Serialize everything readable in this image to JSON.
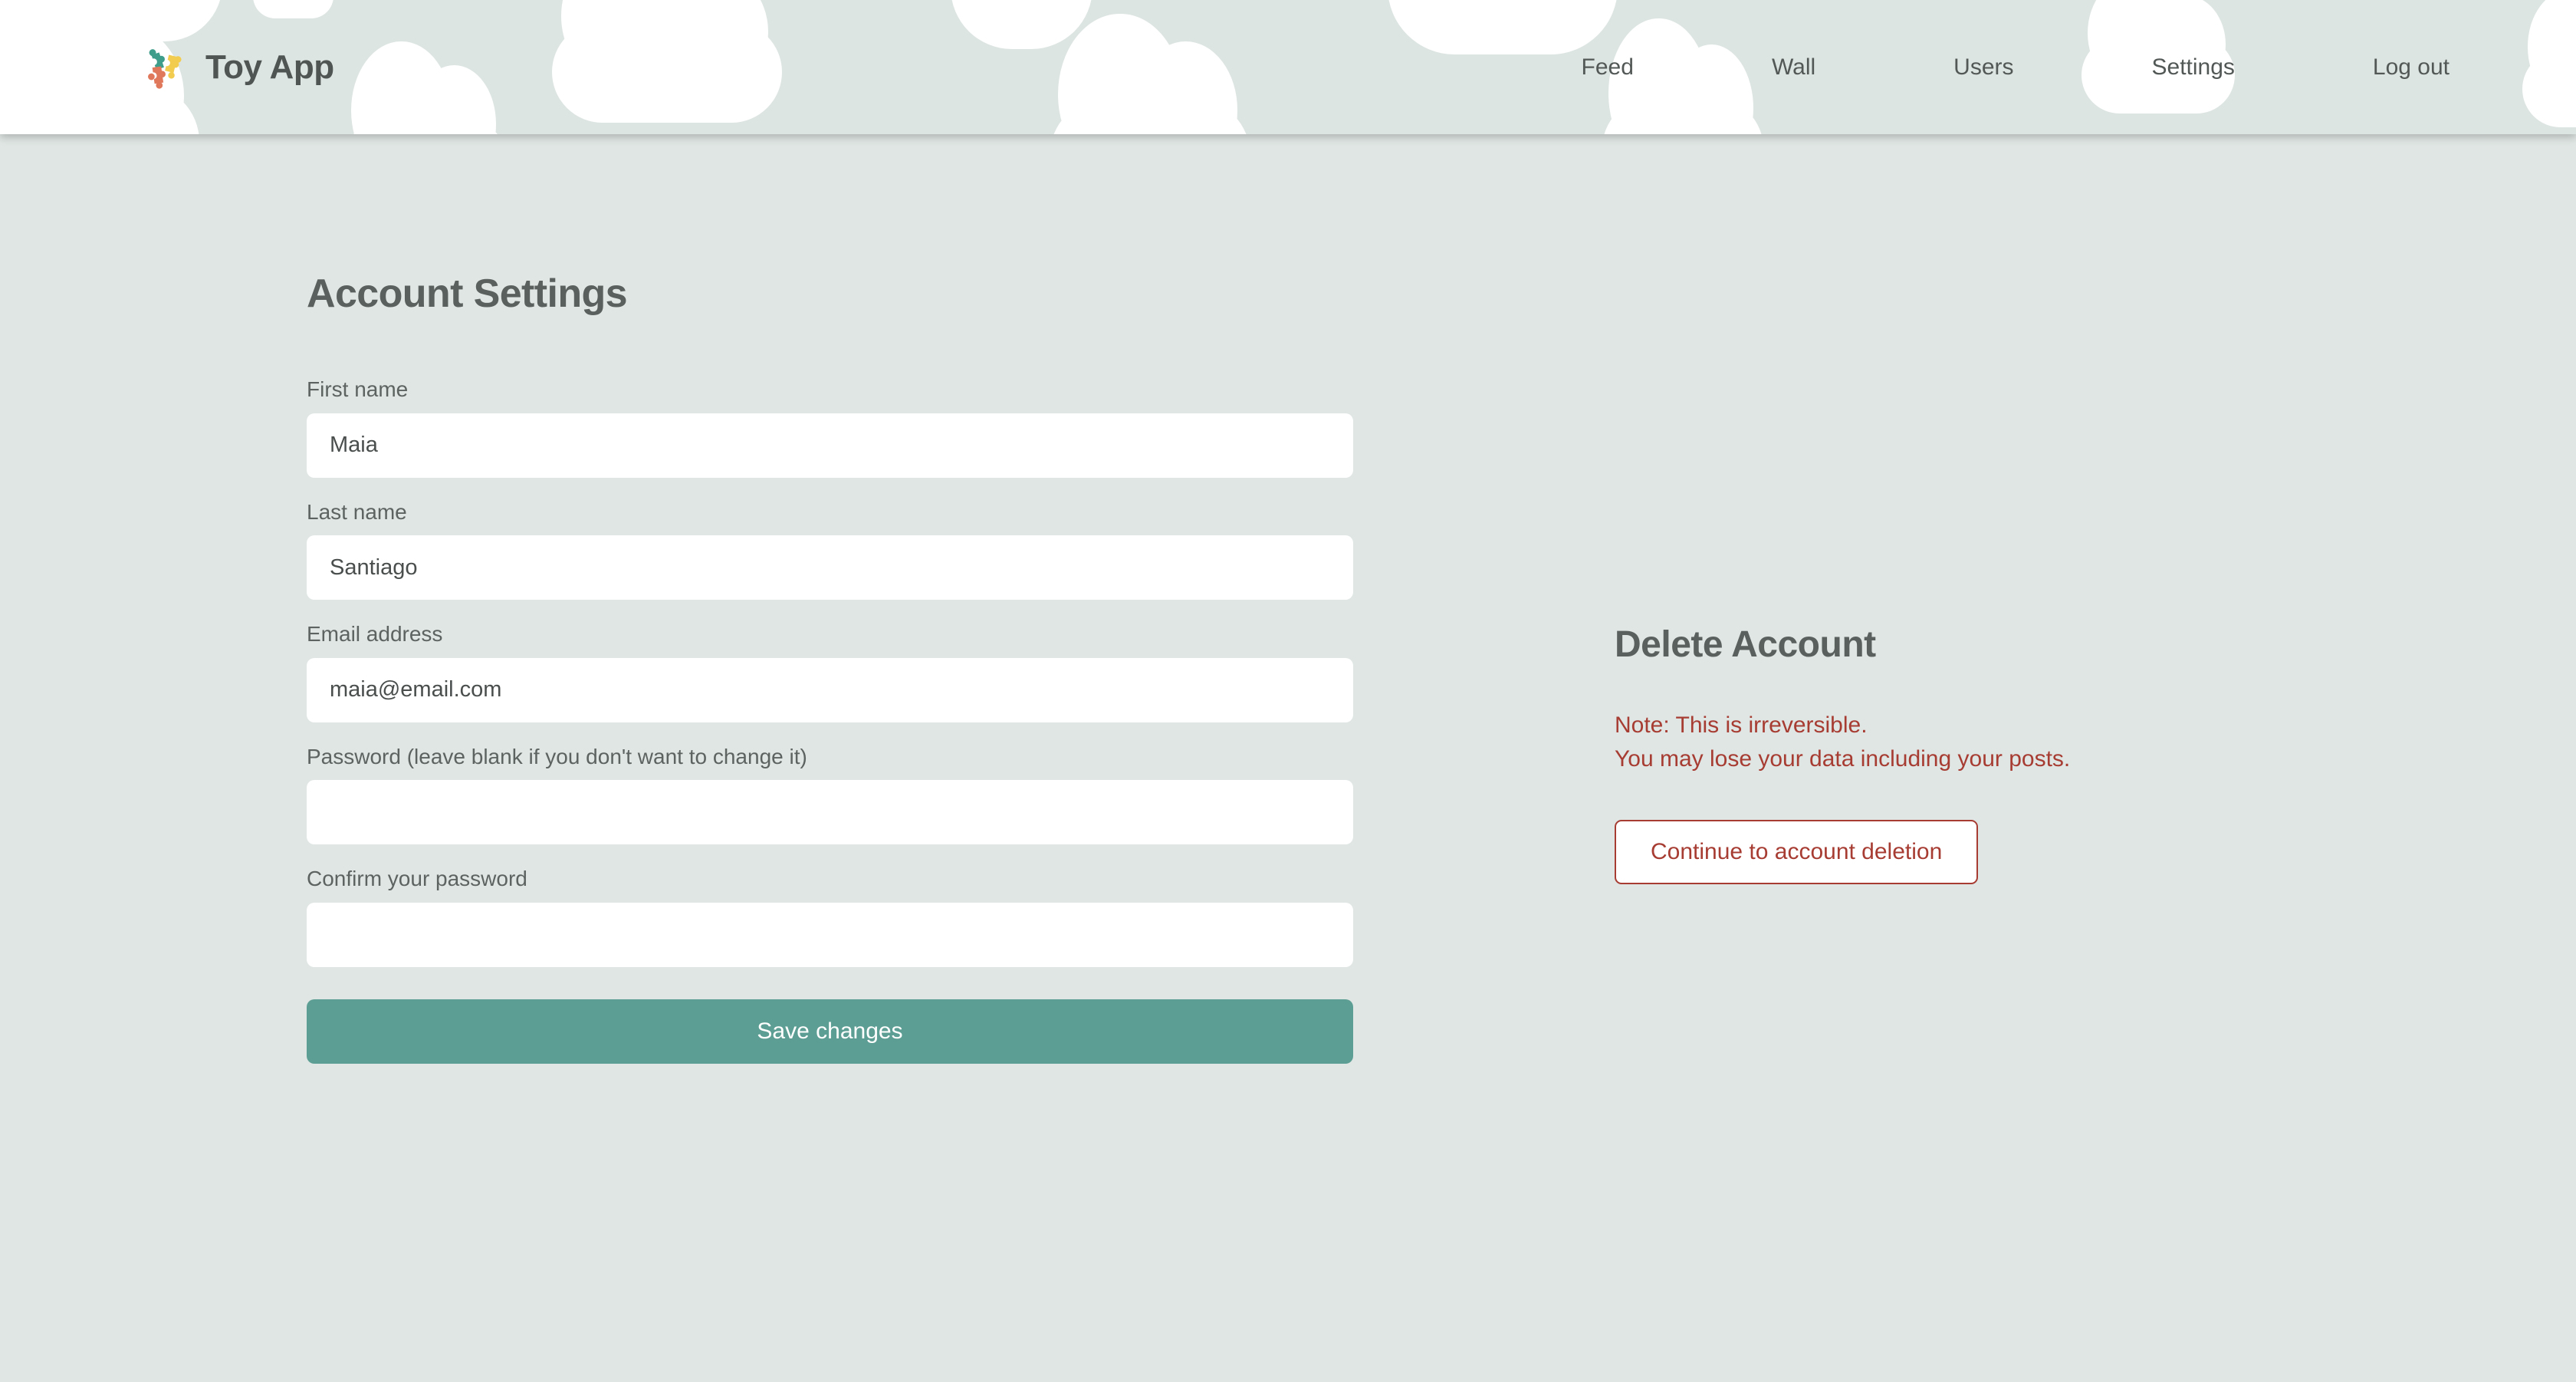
{
  "theme": {
    "background": "#dfe6e3",
    "header_background": "#dde5e2",
    "accent_teal": "#5c9e93",
    "danger_red": "#a73c33",
    "text_grey": "#5a605e",
    "input_background": "#ffffff",
    "cloud_color": "#ffffff",
    "logo_piece_teal": "#3f9e8b",
    "logo_piece_yellow": "#f2cc4e",
    "logo_piece_salmon": "#e0795c"
  },
  "header": {
    "logo_icon": "puzzle-pieces-icon",
    "brand_title": "Toy App",
    "nav": [
      {
        "label": "Feed",
        "active": false
      },
      {
        "label": "Wall",
        "active": false
      },
      {
        "label": "Users",
        "active": false
      },
      {
        "label": "Settings",
        "active": true
      },
      {
        "label": "Log out",
        "active": false
      }
    ]
  },
  "settings": {
    "title": "Account Settings",
    "fields": [
      {
        "label": "First name",
        "value": "Maia",
        "placeholder": "",
        "type": "text"
      },
      {
        "label": "Last name",
        "value": "Santiago",
        "placeholder": "",
        "type": "text"
      },
      {
        "label": "Email address",
        "value": "maia@email.com",
        "placeholder": "",
        "type": "email"
      },
      {
        "label": "Password (leave blank if you don't want to change it)",
        "value": "",
        "placeholder": "",
        "type": "password"
      },
      {
        "label": "Confirm your password",
        "value": "",
        "placeholder": "",
        "type": "password"
      }
    ],
    "save_label": "Save changes"
  },
  "delete_account": {
    "title": "Delete Account",
    "note_line1": "Note: This is irreversible.",
    "note_line2": "You may lose your data including your posts.",
    "button_label": "Continue to account deletion"
  }
}
